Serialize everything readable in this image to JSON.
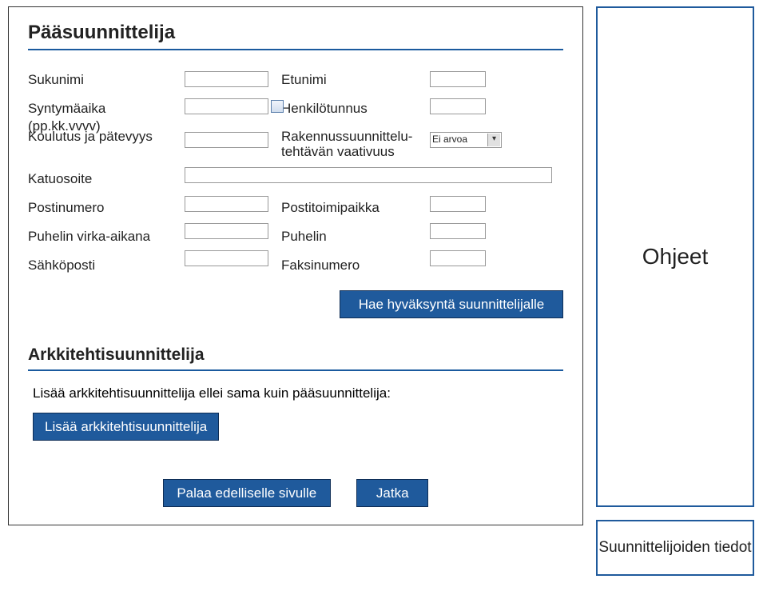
{
  "main": {
    "title": "Pääsuunnittelija",
    "left_labels": {
      "sukunimi": "Sukunimi",
      "syntyma": "Syntymäaika (pp.kk.vvvv)",
      "koulutus": "Koulutus ja pätevyys",
      "katuosoite": "Katuosoite",
      "postinumero": "Postinumero",
      "puhelin_virka": "Puhelin virka-aikana",
      "sahkoposti": "Sähköposti"
    },
    "right_labels": {
      "etunimi": "Etunimi",
      "henkilotunnus": "Henkilötunnus",
      "vaativuus": "Rakennussuunnittelu-\ntehtävän vaativuus",
      "postitoimipaikka": "Postitoimipaikka",
      "puhelin": "Puhelin",
      "faksi": "Faksinumero"
    },
    "select_value": "Ei arvoa",
    "hae_btn": "Hae hyväksyntä suunnittelijalle"
  },
  "arch": {
    "title": "Arkkitehtisuunnittelija",
    "note": "Lisää arkkitehtisuunnittelija ellei sama kuin pääsuunnittelija:",
    "btn": "Lisää arkkitehtisuunnittelija"
  },
  "nav": {
    "back": "Palaa edelliselle sivulle",
    "next": "Jatka"
  },
  "side": {
    "ohjeet": "Ohjeet",
    "footer": "Suunnittelijoiden tiedot"
  }
}
